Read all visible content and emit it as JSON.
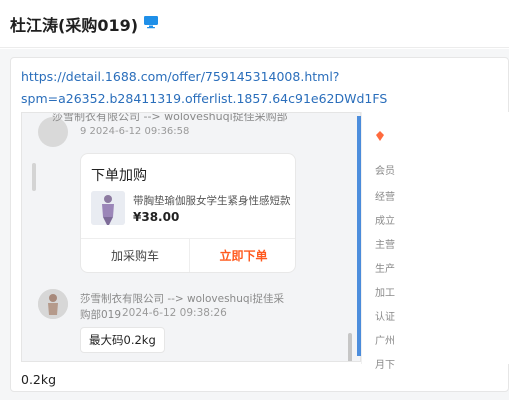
{
  "header": {
    "title": "杜江涛(采购019)",
    "icon": "monitor-icon"
  },
  "message": {
    "link_lines": [
      "https://detail.1688.com/offer/759145314008.html?",
      "spm=a26352.b28411319.offerlist.1857.64c91e62DWd1FS"
    ],
    "caption": "0.2kg"
  },
  "screenshot": {
    "top_msg_name": "莎雪制衣有限公司 --> woloveshuqi捉佳采购部",
    "top_msg_meta": "9    2024-6-12 09:36:58",
    "order_card": {
      "title": "下单加购",
      "product_name": "带胸垫瑜伽服女学生紧身性感短款",
      "price": "¥38.00",
      "cart_label": "加采购车",
      "order_label": "立即下单"
    },
    "bottom_msg_name_line1": "莎雪制衣有限公司 --> woloveshuqi捉佳采",
    "bottom_msg_name_line2": "购部019",
    "bottom_msg_time": "2024-6-12 09:38:26",
    "bottom_msg_text": "最大码0.2kg"
  },
  "side_panel": {
    "items": [
      "会员",
      "经营",
      "成立",
      "主营",
      "生产",
      "加工",
      "认证",
      "广州",
      "月下"
    ]
  },
  "colors": {
    "link": "#2a6ebb",
    "order": "#ff5a1f",
    "badge": "#2f7bd8"
  }
}
